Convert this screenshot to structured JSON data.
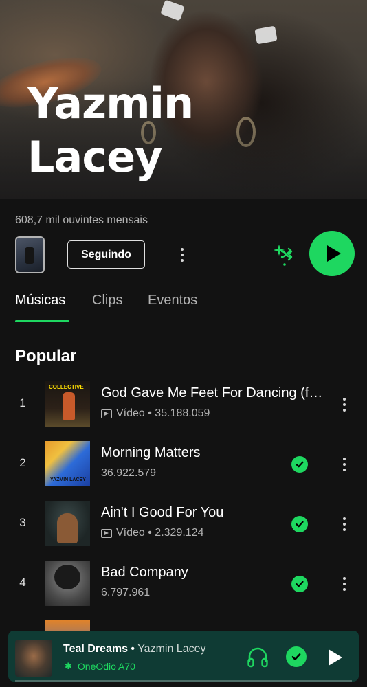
{
  "artist": {
    "name_line1": "Yazmin",
    "name_line2": "Lacey",
    "monthly_listeners": "608,7 mil ouvintes mensais"
  },
  "actions": {
    "follow_label": "Seguindo",
    "more_icon": "more-vertical-icon",
    "shuffle_icon": "smart-shuffle-icon",
    "play_icon": "play-icon"
  },
  "tabs": [
    {
      "label": "Músicas",
      "active": true
    },
    {
      "label": "Clips",
      "active": false
    },
    {
      "label": "Eventos",
      "active": false
    }
  ],
  "popular": {
    "title": "Popular",
    "tracks": [
      {
        "num": "1",
        "title": "God Gave Me Feet For Dancing (feat. Yazmin Lacey)",
        "meta": "Vídeo • 35.188.059",
        "video": true,
        "saved": false
      },
      {
        "num": "2",
        "title": "Morning Matters",
        "meta": "36.922.579",
        "video": false,
        "saved": true
      },
      {
        "num": "3",
        "title": "Ain't I Good For You",
        "meta": "Vídeo • 2.329.124",
        "video": true,
        "saved": true
      },
      {
        "num": "4",
        "title": "Bad Company",
        "meta": "6.797.961",
        "video": false,
        "saved": true
      }
    ]
  },
  "now_playing": {
    "title": "Teal Dreams",
    "separator": " • ",
    "artist": "Yazmin Lacey",
    "device": "OneOdio A70"
  },
  "colors": {
    "accent": "#1ed760",
    "background": "#121212",
    "mini_player_bg": "#0f3b34"
  }
}
